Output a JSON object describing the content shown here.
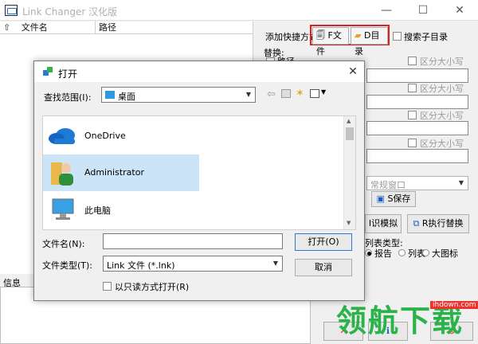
{
  "window": {
    "title": "Link Changer 汉化版",
    "minimize": "—",
    "maximize": "☐",
    "close": "✕"
  },
  "list": {
    "col_file": "文件名",
    "col_path": "路径"
  },
  "toolbar": {
    "add_shortcut_label": "添加快捷方式",
    "file_button": "F文件",
    "dir_button": "D目录",
    "search_subdirs": "搜索子目录"
  },
  "replace": {
    "label": "替换:",
    "path_label": "路径",
    "case_sensitive": "区分大小写"
  },
  "panel": {
    "window_combo": "常规窗口",
    "save_button": "S保存",
    "simulate_button": "I识模拟",
    "run_replace_button": "R执行替换",
    "list_type_label": "列表类型:",
    "radio_report": "报告",
    "radio_list": "列表",
    "radio_large_icon": "大图标"
  },
  "info": {
    "label": "信息"
  },
  "watermark": {
    "text": "领航下载",
    "url": "ihdown.com"
  },
  "dialog": {
    "title": "打开",
    "lookin_label": "查找范围(I):",
    "lookin_value": "桌面",
    "places": [
      {
        "label": "OneDrive"
      },
      {
        "label": "Administrator"
      },
      {
        "label": "此电脑"
      }
    ],
    "filename_label": "文件名(N):",
    "filename_value": "",
    "filetype_label": "文件类型(T):",
    "filetype_value": "Link 文件 (*.lnk)",
    "readonly_label": "以只读方式打开(R)",
    "open_button": "打开(O)",
    "cancel_button": "取消"
  }
}
